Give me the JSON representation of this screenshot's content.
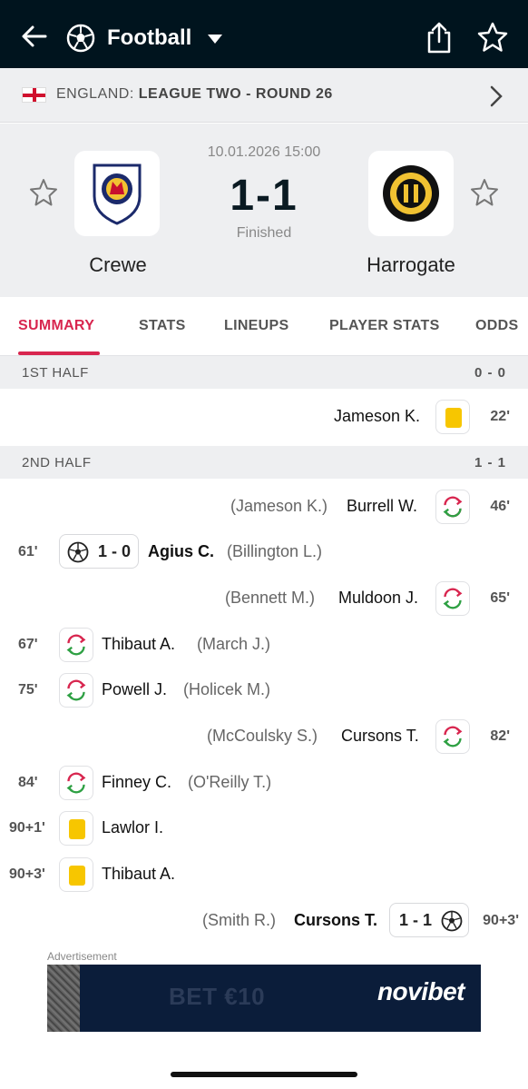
{
  "header": {
    "title": "Football"
  },
  "league": {
    "country": "ENGLAND:",
    "competition": "LEAGUE TWO - ROUND 26"
  },
  "match": {
    "datetime": "10.01.2026 15:00",
    "score": "1-1",
    "status": "Finished",
    "home": {
      "name": "Crewe"
    },
    "away": {
      "name": "Harrogate"
    }
  },
  "tabs": [
    "SUMMARY",
    "STATS",
    "LINEUPS",
    "PLAYER STATS",
    "ODDS"
  ],
  "sections": {
    "first_half": {
      "label": "1ST HALF",
      "score": "0 - 0"
    },
    "second_half": {
      "label": "2ND HALF",
      "score": "1 - 1"
    }
  },
  "events": {
    "e1": {
      "minute": "22'",
      "player": "Jameson K."
    },
    "e2": {
      "minute": "46'",
      "player": "Burrell W.",
      "assist": "(Jameson K.)"
    },
    "e3": {
      "minute": "61'",
      "score": "1 - 0",
      "player": "Agius C.",
      "assist": "(Billington L.)"
    },
    "e4": {
      "minute": "65'",
      "player": "Muldoon J.",
      "assist": "(Bennett M.)"
    },
    "e5": {
      "minute": "67'",
      "player": "Thibaut A.",
      "assist": "(March J.)"
    },
    "e6": {
      "minute": "75'",
      "player": "Powell J.",
      "assist": "(Holicek M.)"
    },
    "e7": {
      "minute": "82'",
      "player": "Cursons T.",
      "assist": "(McCoulsky S.)"
    },
    "e8": {
      "minute": "84'",
      "player": "Finney C.",
      "assist": "(O'Reilly T.)"
    },
    "e9": {
      "minute": "90+1'",
      "player": "Lawlor I."
    },
    "e10": {
      "minute": "90+3'",
      "player": "Thibaut A."
    },
    "e11": {
      "minute": "90+3'",
      "score": "1 - 1",
      "player": "Cursons T.",
      "assist": "(Smith R.)"
    }
  },
  "ad": {
    "label": "Advertisement",
    "text": "BET €10",
    "brand": "novibet"
  },
  "colors": {
    "topbar": "#00141e",
    "accent": "#d8264f",
    "yellow_card": "#f7c600",
    "sub_green": "#2ea043",
    "sub_red": "#d8264f"
  }
}
